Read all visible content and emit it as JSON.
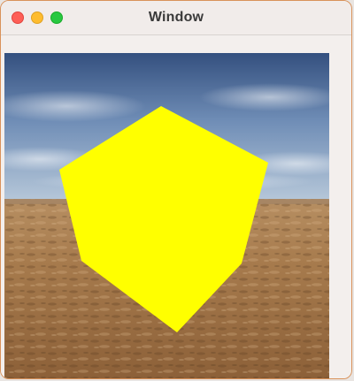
{
  "window": {
    "title": "Window"
  },
  "titlebar_buttons": [
    "close",
    "minimize",
    "maximize"
  ],
  "colors": {
    "cube_face": "#ffff00",
    "close": "#fe5f57",
    "minimize": "#febc2e",
    "maximize": "#28c840",
    "sky_top": "#3f5a8c",
    "sky_bottom": "#9cb4cf",
    "sand_light": "#caa273",
    "sand_dark": "#6b4a2d"
  },
  "scene": {
    "object": "yellow-cube",
    "background": "desert-sky-skybox"
  }
}
